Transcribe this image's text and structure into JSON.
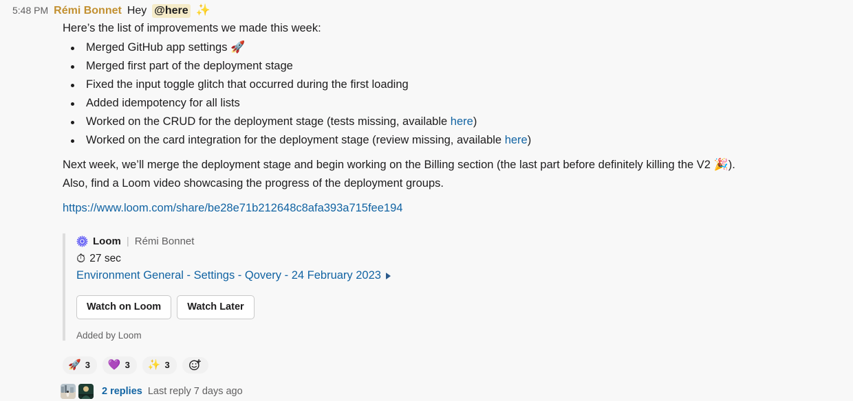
{
  "message": {
    "timestamp": "5:48 PM",
    "author": "Rémi Bonnet",
    "greeting": "Hey",
    "mention": "@here",
    "greeting_emoji": "✨",
    "intro": "Here’s the list of improvements we made this week:",
    "bullets": [
      {
        "text": "Merged GitHub app settings ",
        "emoji": "🚀",
        "tail": "",
        "link": null
      },
      {
        "text": "Merged first part of the deployment stage",
        "emoji": "",
        "tail": "",
        "link": null
      },
      {
        "text": "Fixed the input toggle glitch that occurred during the first loading",
        "emoji": "",
        "tail": "",
        "link": null
      },
      {
        "text": "Added idempotency for all lists",
        "emoji": "",
        "tail": "",
        "link": null
      },
      {
        "text": "Worked on the CRUD for the deployment stage (tests missing, available ",
        "emoji": "",
        "tail": ")",
        "link": "here"
      },
      {
        "text": "Worked on the card integration for the deployment stage (review missing, available ",
        "emoji": "",
        "tail": ")",
        "link": "here"
      }
    ],
    "paragraph_1_part1": "Next week, we’ll merge the deployment stage and begin working on the Billing section (the last part before definitely killing the V2 ",
    "paragraph_1_emoji": "🎉",
    "paragraph_1_part2": ").",
    "paragraph_2": "Also, find a Loom video showcasing the progress of the deployment groups.",
    "url": "https://www.loom.com/share/be28e71b212648c8afa393a715fee194"
  },
  "attachment": {
    "service_name": "Loom",
    "divider": "|",
    "author": "Rémi Bonnet",
    "duration_emoji": "⏱",
    "duration": "27 sec",
    "title": "Environment General - Settings - Qovery - 24 February 2023",
    "buttons": [
      {
        "label": "Watch on Loom"
      },
      {
        "label": "Watch Later"
      }
    ],
    "footer": "Added by Loom",
    "icon_color": "#625DF5"
  },
  "reactions": [
    {
      "emoji": "🚀",
      "count": "3"
    },
    {
      "emoji": "💜",
      "count": "3"
    },
    {
      "emoji": "✨",
      "count": "3"
    }
  ],
  "add_reaction_icon": "😀+",
  "thread": {
    "replies_label": "2 replies",
    "last_reply": "Last reply 7 days ago"
  },
  "colors": {
    "background": "#F8F8F8",
    "text": "#1D1C1D",
    "link": "#1264A3",
    "author": "#C29030",
    "mention_bg": "#F5EBC8",
    "muted": "#616061"
  }
}
